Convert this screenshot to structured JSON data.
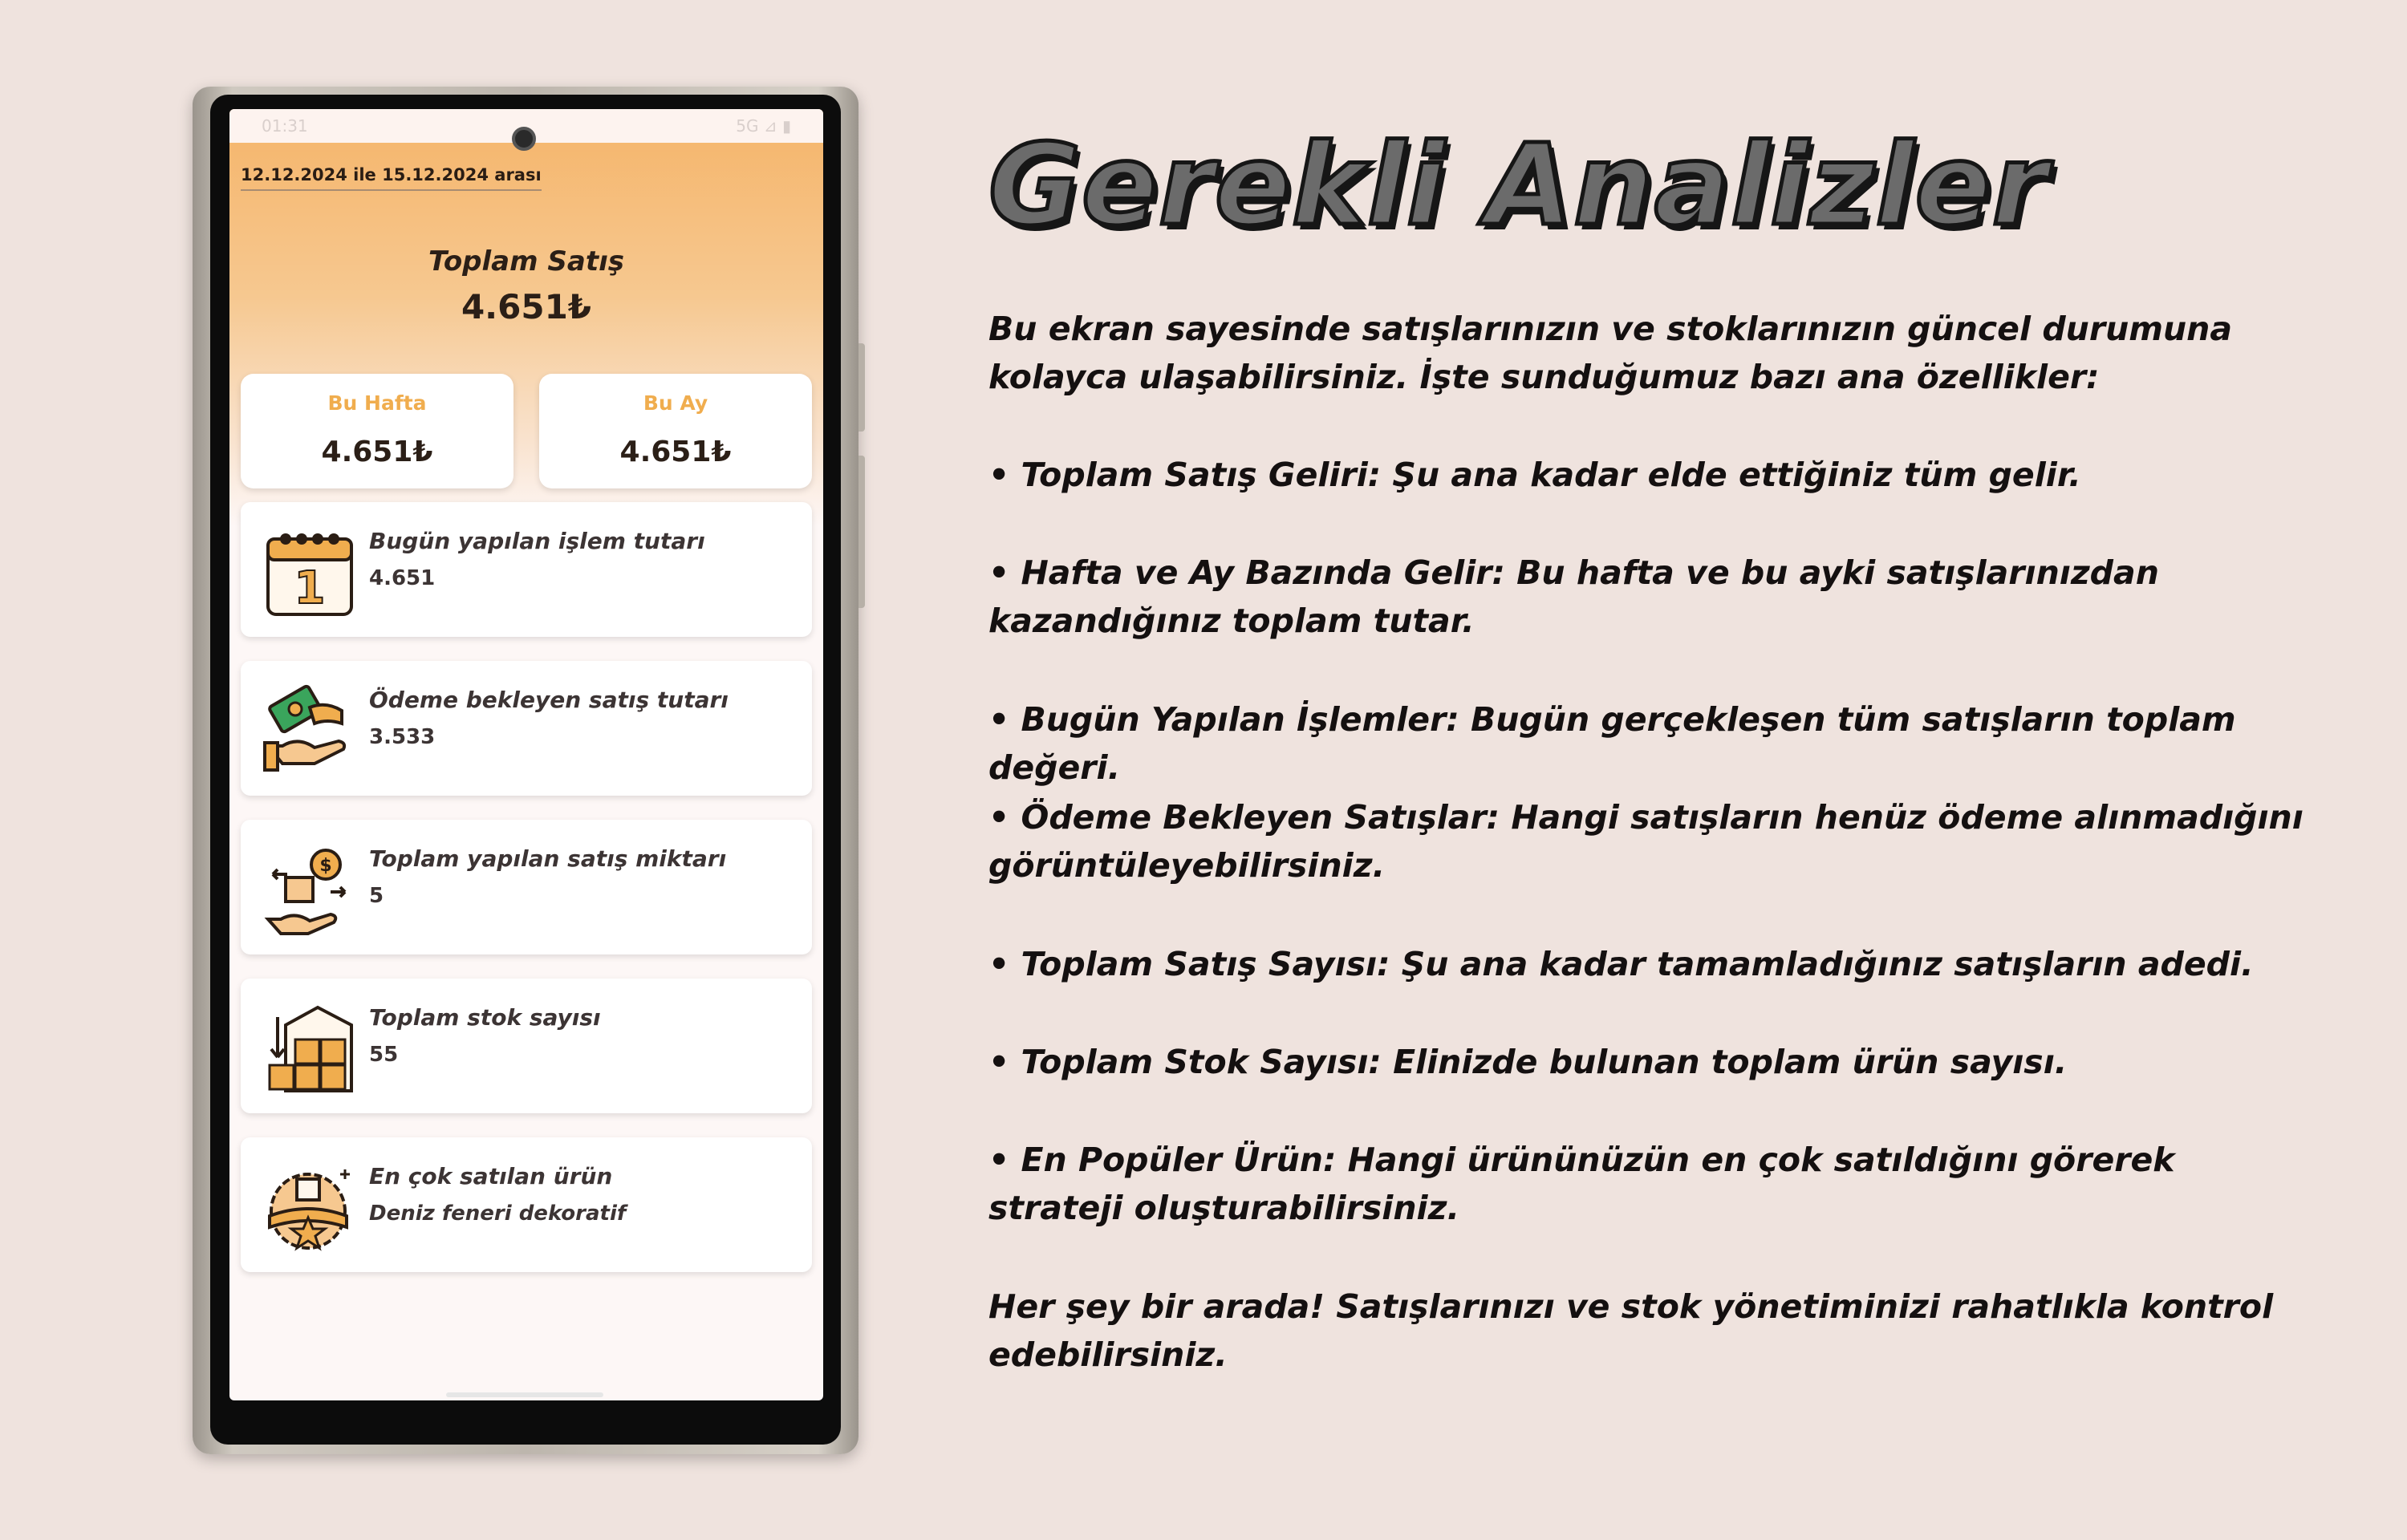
{
  "phone": {
    "status_time": "01:31",
    "status_icons": "5G ⊿ ▮",
    "date_range": "12.12.2024 ile 15.12.2024 arası",
    "total_sales_title": "Toplam Satış",
    "total_sales_value": "4.651₺",
    "week_card": {
      "label": "Bu Hafta",
      "value": "4.651₺"
    },
    "month_card": {
      "label": "Bu Ay",
      "value": "4.651₺"
    },
    "stats": [
      {
        "icon": "calendar-icon",
        "label": "Bugün yapılan işlem tutarı",
        "value": "4.651"
      },
      {
        "icon": "money-hand-icon",
        "label": "Ödeme bekleyen satış tutarı",
        "value": "3.533"
      },
      {
        "icon": "sale-exchange-icon",
        "label": "Toplam yapılan satış miktarı",
        "value": "5"
      },
      {
        "icon": "warehouse-icon",
        "label": "Toplam stok sayısı",
        "value": "55"
      },
      {
        "icon": "badge-star-icon",
        "label": "En çok satılan ürün",
        "value": "Deniz feneri dekoratif"
      }
    ]
  },
  "info": {
    "heading": "Gerekli Analizler",
    "intro": "Bu ekran sayesinde satışlarınızın ve stoklarınızın güncel durumuna kolayca ulaşabilirsiniz. İşte sunduğumuz bazı ana özellikler:",
    "bullets": [
      "• Toplam Satış Geliri: Şu ana kadar elde ettiğiniz tüm gelir.",
      "• Hafta ve Ay Bazında Gelir: Bu hafta ve bu ayki satışlarınızdan kazandığınız toplam tutar.",
      "• Bugün Yapılan İşlemler: Bugün gerçekleşen tüm satışların toplam değeri.",
      "• Ödeme Bekleyen Satışlar: Hangi satışların henüz ödeme alınmadığını görüntüleyebilirsiniz.",
      "• Toplam Satış Sayısı: Şu ana kadar tamamladığınız satışların adedi.",
      "• Toplam Stok Sayısı: Elinizde bulunan toplam ürün sayısı.",
      "• En Popüler Ürün: Hangi ürününüzün en çok satıldığını görerek strateji oluşturabilirsiniz."
    ],
    "closing": "Her şey bir arada! Satışlarınızı ve stok yönetiminizi rahatlıkla kontrol edebilirsiniz."
  }
}
